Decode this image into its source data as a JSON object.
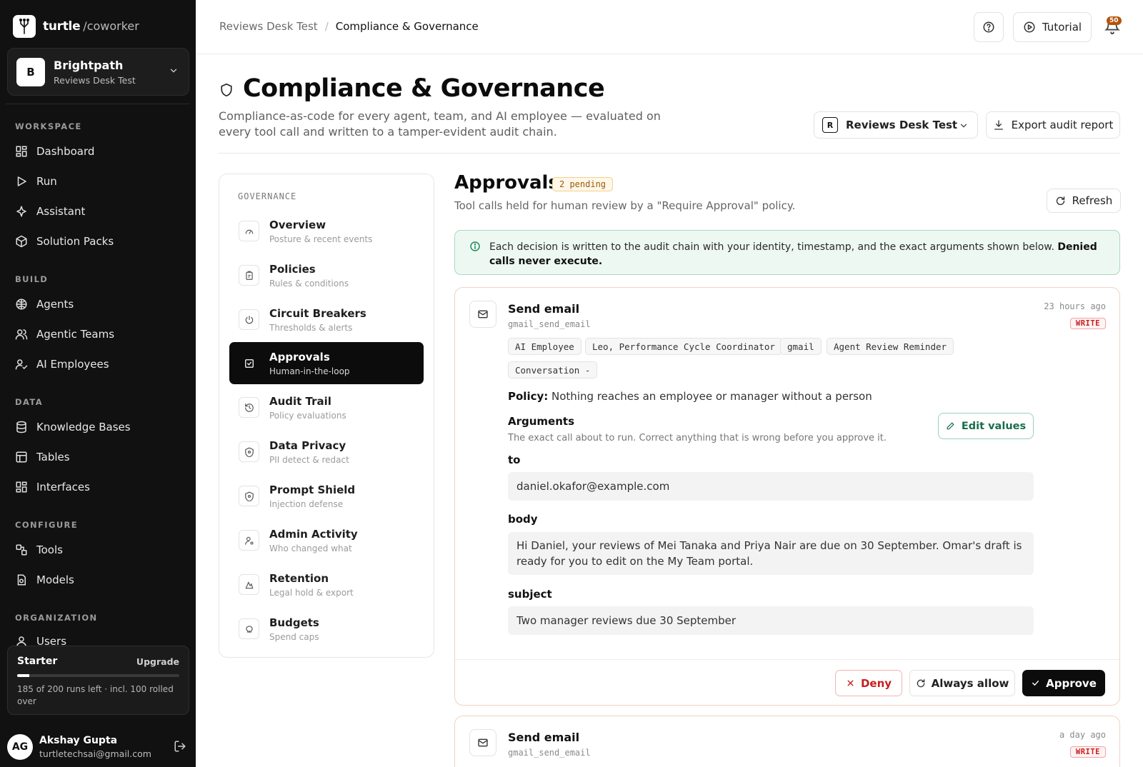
{
  "brand": {
    "name": "turtle",
    "suffix": "/coworker"
  },
  "workspace": {
    "initial": "B",
    "name": "Brightpath",
    "org": "Reviews Desk Test"
  },
  "sidebar": {
    "sections": [
      {
        "label": "WORKSPACE",
        "items": [
          {
            "label": "Dashboard",
            "icon": "dashboard-icon"
          },
          {
            "label": "Run",
            "icon": "play-icon"
          },
          {
            "label": "Assistant",
            "icon": "sparkle-icon"
          },
          {
            "label": "Solution Packs",
            "icon": "package-icon"
          }
        ]
      },
      {
        "label": "BUILD",
        "items": [
          {
            "label": "Agents",
            "icon": "brain-icon"
          },
          {
            "label": "Agentic Teams",
            "icon": "users-icon"
          },
          {
            "label": "AI Employees",
            "icon": "user-check-icon"
          }
        ]
      },
      {
        "label": "DATA",
        "items": [
          {
            "label": "Knowledge Bases",
            "icon": "database-icon"
          },
          {
            "label": "Tables",
            "icon": "table-icon"
          },
          {
            "label": "Interfaces",
            "icon": "layout-icon"
          }
        ]
      },
      {
        "label": "CONFIGURE",
        "items": [
          {
            "label": "Tools",
            "icon": "tools-icon"
          },
          {
            "label": "Models",
            "icon": "model-icon"
          }
        ]
      },
      {
        "label": "ORGANIZATION",
        "items": [
          {
            "label": "Users",
            "icon": "user-icon"
          }
        ]
      }
    ]
  },
  "plan": {
    "name": "Starter",
    "upgrade": "Upgrade",
    "usage": "185 of 200 runs left · incl. 100 rolled over",
    "used_fraction": 0.075
  },
  "user": {
    "initials": "AG",
    "name": "Akshay Gupta",
    "email": "turtletechsai@gmail.com"
  },
  "topbar": {
    "crumb_parent": "Reviews Desk Test",
    "crumb_current": "Compliance & Governance",
    "tutorial_label": "Tutorial",
    "notification_count": "50"
  },
  "page": {
    "title": "Compliance & Governance",
    "description": "Compliance-as-code for every agent, team, and AI employee — evaluated on every tool call and written to a tamper-evident audit chain.",
    "workspace_select": {
      "initial": "R",
      "label": "Reviews Desk Test"
    },
    "export_label": "Export audit report"
  },
  "governance": {
    "heading": "GOVERNANCE",
    "items": [
      {
        "title": "Overview",
        "subtitle": "Posture & recent events",
        "icon": "gauge-icon"
      },
      {
        "title": "Policies",
        "subtitle": "Rules & conditions",
        "icon": "clipboard-icon"
      },
      {
        "title": "Circuit Breakers",
        "subtitle": "Thresholds & alerts",
        "icon": "power-icon"
      },
      {
        "title": "Approvals",
        "subtitle": "Human-in-the-loop",
        "icon": "check-square-icon",
        "active": true
      },
      {
        "title": "Audit Trail",
        "subtitle": "Policy evaluations",
        "icon": "history-icon"
      },
      {
        "title": "Data Privacy",
        "subtitle": "PII detect & redact",
        "icon": "shield-icon"
      },
      {
        "title": "Prompt Shield",
        "subtitle": "Injection defense",
        "icon": "shield-alert-icon"
      },
      {
        "title": "Admin Activity",
        "subtitle": "Who changed what",
        "icon": "user-cog-icon"
      },
      {
        "title": "Retention",
        "subtitle": "Legal hold & export",
        "icon": "archive-icon"
      },
      {
        "title": "Budgets",
        "subtitle": "Spend caps",
        "icon": "piggy-bank-icon"
      }
    ]
  },
  "approvals": {
    "title": "Approvals",
    "pending_badge": "2 pending",
    "subtitle": "Tool calls held for human review by a \"Require Approval\" policy.",
    "refresh_label": "Refresh",
    "info_text": "Each decision is written to the audit chain with your identity, timestamp, and the exact arguments shown below.",
    "info_bold": "Denied calls never execute.",
    "cards": [
      {
        "title": "Send email",
        "function": "gmail_send_email",
        "time": "23 hours ago",
        "mode": "WRITE",
        "tags": [
          "AI Employee",
          "Leo, Performance Cycle Coordinator",
          "gmail",
          "Agent Review Reminder",
          "Conversation -"
        ],
        "policy_label": "Policy:",
        "policy": "Nothing reaches an employee or manager without a person",
        "arguments_title": "Arguments",
        "arguments_sub": "The exact call about to run. Correct anything that is wrong before you approve it.",
        "edit_label": "Edit values",
        "fields": [
          {
            "name": "to",
            "value": "daniel.okafor@example.com"
          },
          {
            "name": "body",
            "value": "Hi Daniel, your reviews of Mei Tanaka and Priya Nair are due on 30 September. Omar's draft is ready for you to edit on the My Team portal."
          },
          {
            "name": "subject",
            "value": "Two manager reviews due 30 September"
          }
        ],
        "deny_label": "Deny",
        "always_allow_label": "Always allow",
        "approve_label": "Approve"
      },
      {
        "title": "Send email",
        "function": "gmail_send_email",
        "time": "a day ago",
        "mode": "WRITE"
      }
    ]
  }
}
